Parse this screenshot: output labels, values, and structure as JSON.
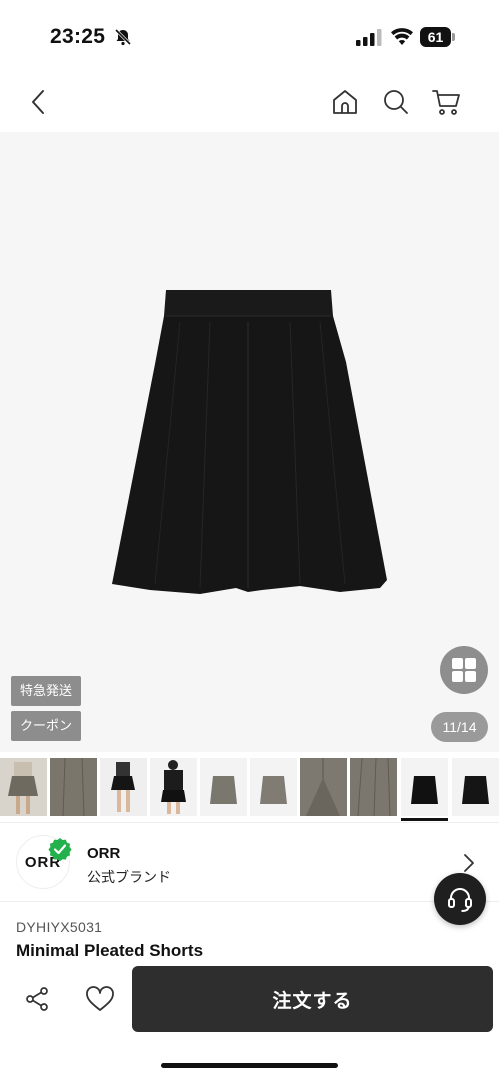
{
  "status_bar": {
    "time": "23:25",
    "battery": "61"
  },
  "nav": {
    "icons": [
      "chevron-left-icon",
      "home-icon",
      "search-icon",
      "cart-icon"
    ]
  },
  "gallery": {
    "tags": [
      "特急発送",
      "クーポン"
    ],
    "counter": "11/14",
    "active_thumbnail": 9,
    "thumbnail_count": 10
  },
  "brand": {
    "logo_text": "ORR",
    "name": "ORR",
    "subtitle": "公式ブランド"
  },
  "product": {
    "code": "DYHIYX5031",
    "title": "Minimal Pleated Shorts"
  },
  "actions": {
    "order_label": "注文する"
  },
  "colors": {
    "order_button": "#2e2e2e",
    "verified": "#22b14c",
    "tag": "#8d8d8d"
  }
}
